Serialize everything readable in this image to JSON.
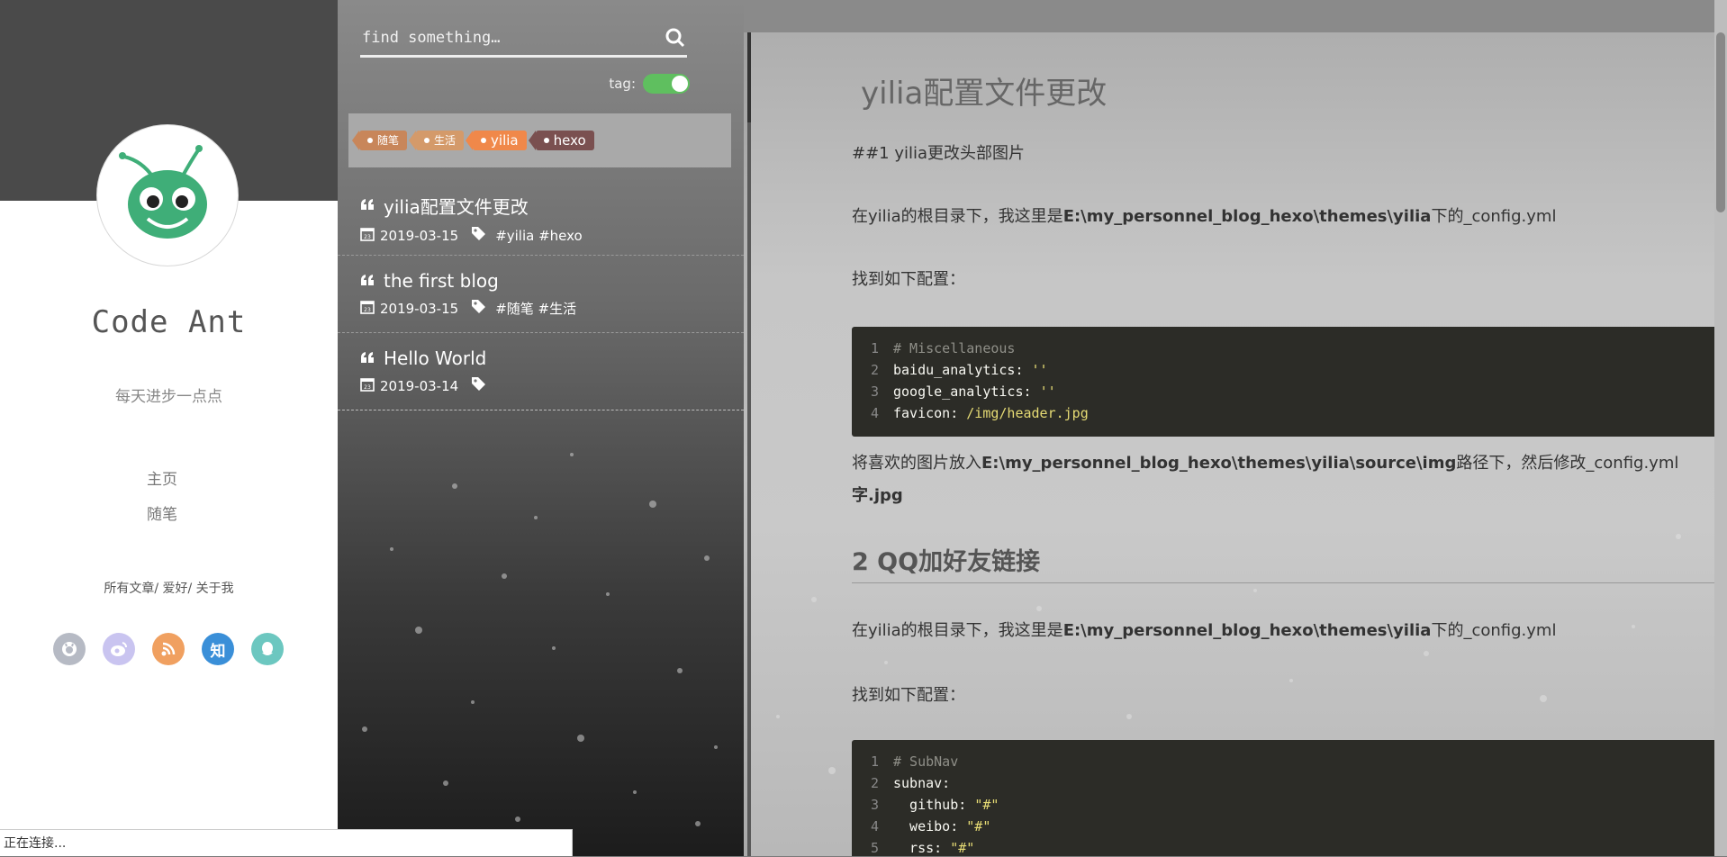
{
  "profile": {
    "site_title": "Code Ant",
    "subtitle": "每天进步一点点",
    "avatar_icon": "ant-avatar-icon",
    "nav": [
      {
        "label": "主页"
      },
      {
        "label": "随笔"
      }
    ],
    "sub_links": [
      "所有文章",
      "爱好",
      "关于我"
    ],
    "sub_link_separator": "/",
    "social": [
      {
        "name": "github-icon",
        "glyph": "",
        "color": "#b6bac4"
      },
      {
        "name": "weibo-icon",
        "glyph": "",
        "color": "#c9c4f0"
      },
      {
        "name": "rss-icon",
        "glyph": "",
        "color": "#f0a060"
      },
      {
        "name": "zhihu-icon",
        "glyph": "知",
        "color": "#3a8fd8"
      },
      {
        "name": "qq-icon",
        "glyph": "",
        "color": "#6cc7c0"
      }
    ]
  },
  "search": {
    "placeholder": "find something…",
    "icon": "search-icon"
  },
  "tag_toggle": {
    "label": "tag:",
    "on": true
  },
  "tags": [
    {
      "label": "随笔",
      "color": "#c8865a",
      "size": "small"
    },
    {
      "label": "生活",
      "color": "#d49a6a",
      "size": "small"
    },
    {
      "label": "yilia",
      "color": "#f0884a",
      "size": "big"
    },
    {
      "label": "hexo",
      "color": "#7a5050",
      "size": "big"
    }
  ],
  "posts": [
    {
      "title": "yilia配置文件更改",
      "date": "2019-03-15",
      "tags": "#yilia #hexo"
    },
    {
      "title": "the first blog",
      "date": "2019-03-15",
      "tags": "#随笔 #生活"
    },
    {
      "title": "Hello World",
      "date": "2019-03-14",
      "tags": ""
    }
  ],
  "article": {
    "title": "yilia配置文件更改",
    "p1": "##1 yilia更改头部图片",
    "p2_prefix": " 在yilia的根目录下，我这里是",
    "p2_path": "E:\\my_personnel_blog_hexo\\themes\\yilia",
    "p2_suffix": "下的_config.yml",
    "p3": "找到如下配置：",
    "code1": [
      {
        "n": "1",
        "parts": [
          {
            "t": "# Miscellaneous",
            "c": "comment"
          }
        ]
      },
      {
        "n": "2",
        "parts": [
          {
            "t": "baidu_analytics: ",
            "c": "key"
          },
          {
            "t": "''",
            "c": "str"
          }
        ]
      },
      {
        "n": "3",
        "parts": [
          {
            "t": "google_analytics: ",
            "c": "key"
          },
          {
            "t": "''",
            "c": "str"
          }
        ]
      },
      {
        "n": "4",
        "parts": [
          {
            "t": "favicon: ",
            "c": "key"
          },
          {
            "t": "/img/header.jpg",
            "c": "str"
          }
        ]
      }
    ],
    "p4_prefix": "将喜欢的图片放入",
    "p4_path": "E:\\my_personnel_blog_hexo\\themes\\yilia\\source\\img",
    "p4_suffix": "路径下，然后修改_config.yml",
    "p4_line2": "字.jpg",
    "h2": "2 QQ加好友链接",
    "p5_prefix": " 在yilia的根目录下，我这里是",
    "p5_path": "E:\\my_personnel_blog_hexo\\themes\\yilia",
    "p5_suffix": "下的_config.yml",
    "p6": "找到如下配置：",
    "code2": [
      {
        "n": "1",
        "parts": [
          {
            "t": "# SubNav",
            "c": "comment"
          }
        ]
      },
      {
        "n": "2",
        "parts": [
          {
            "t": "subnav:",
            "c": "key"
          }
        ]
      },
      {
        "n": "3",
        "parts": [
          {
            "t": "  github: ",
            "c": "key"
          },
          {
            "t": "\"#\"",
            "c": "str"
          }
        ]
      },
      {
        "n": "4",
        "parts": [
          {
            "t": "  weibo: ",
            "c": "key"
          },
          {
            "t": "\"#\"",
            "c": "str"
          }
        ]
      },
      {
        "n": "5",
        "parts": [
          {
            "t": "  rss: ",
            "c": "key"
          },
          {
            "t": "\"#\"",
            "c": "str"
          }
        ]
      }
    ]
  },
  "status_bar": {
    "text": "正在连接..."
  }
}
